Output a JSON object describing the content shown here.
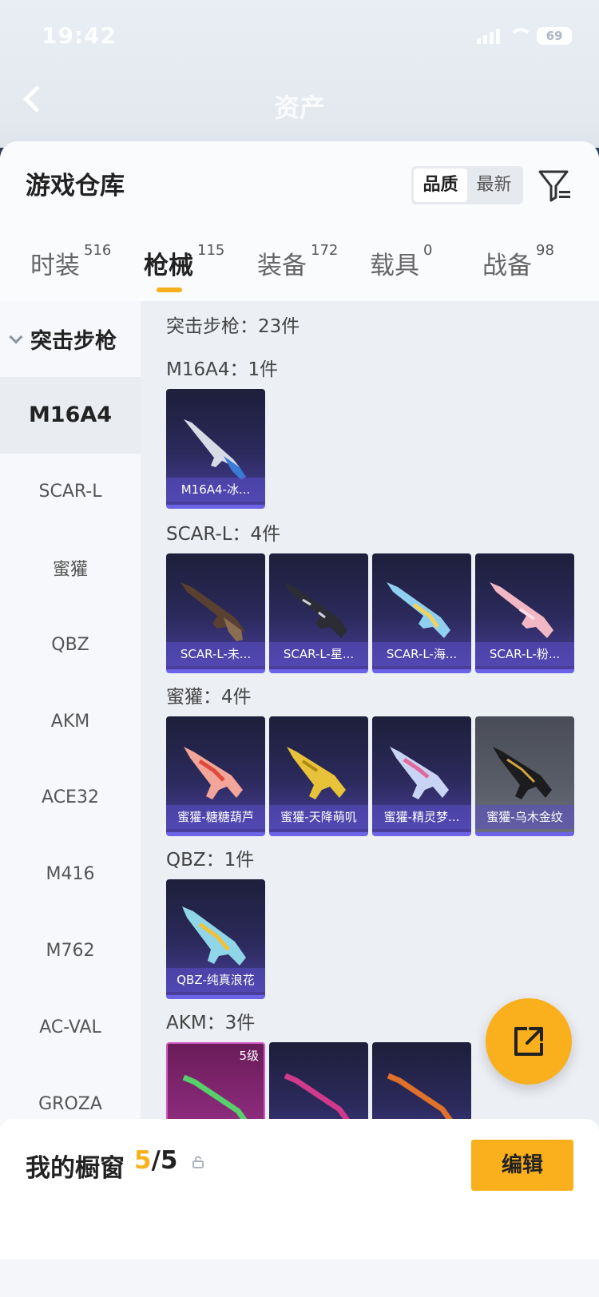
{
  "status_bar": {
    "time": "19:42",
    "battery": "69"
  },
  "header": {
    "title": "资产"
  },
  "sheet": {
    "title": "游戏仓库",
    "sort_options": [
      "品质",
      "最新"
    ],
    "tabs": [
      {
        "label": "时装",
        "count": "516"
      },
      {
        "label": "枪械",
        "count": "115"
      },
      {
        "label": "装备",
        "count": "172"
      },
      {
        "label": "载具",
        "count": "0"
      },
      {
        "label": "战备",
        "count": "98"
      }
    ]
  },
  "categories": {
    "group": "突击步枪",
    "items": [
      "M16A4",
      "SCAR-L",
      "蜜獾",
      "QBZ",
      "AKM",
      "ACE32",
      "M416",
      "M762",
      "AC-VAL",
      "GROZA"
    ]
  },
  "content": {
    "total": "突击步枪：23件",
    "sections": [
      {
        "title": "M16A4：1件",
        "cards": [
          "M16A4-冰..."
        ]
      },
      {
        "title": "SCAR-L：4件",
        "cards": [
          "SCAR-L-未...",
          "SCAR-L-星...",
          "SCAR-L-海...",
          "SCAR-L-粉..."
        ]
      },
      {
        "title": "蜜獾：4件",
        "cards": [
          "蜜獾-糖糖葫芦",
          "蜜獾-天降萌叽",
          "蜜獾-精灵梦...",
          "蜜獾-乌木金纹"
        ]
      },
      {
        "title": "QBZ：1件",
        "cards": [
          "QBZ-纯真浪花"
        ]
      },
      {
        "title": "AKM：3件",
        "level_badge": "5级"
      }
    ]
  },
  "bottom": {
    "label": "我的橱窗",
    "current": "5",
    "total": "/5",
    "edit_button": "编辑"
  },
  "colors": {
    "accent": "#f9b01c",
    "card_border": "#6c63e8"
  }
}
